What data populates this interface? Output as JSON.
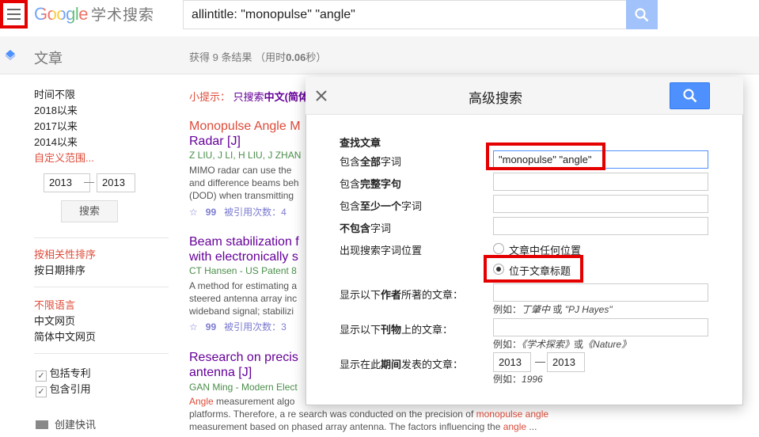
{
  "header": {
    "logo_google": "Google",
    "logo_scholar": "学术搜索",
    "search_value": "allintitle: \"monopulse\" \"angle\"",
    "search_btn_color": "#a1c2fa"
  },
  "nav": {
    "articles": "文章",
    "results_count": "获得 9 条结果 （用时",
    "results_time": "0.06",
    "results_unit": "秒）"
  },
  "sidebar": {
    "time_any": "时间不限",
    "since_2018": "2018以来",
    "since_2017": "2017以来",
    "since_2014": "2014以来",
    "custom_range": "自定义范围...",
    "year_from": "2013",
    "year_dash": "—",
    "year_to": "2013",
    "search_btn": "搜索",
    "sort_relevance": "按相关性排序",
    "sort_date": "按日期排序",
    "lang_any": "不限语言",
    "lang_cn_web": "中文网页",
    "lang_simplified": "简体中文网页",
    "include_patents": "包括专利",
    "include_citations": "包含引用",
    "create_alert": "创建快讯"
  },
  "tip": {
    "label": "小提示：",
    "text": "只搜索",
    "bold": "中文(简体"
  },
  "results": [
    {
      "title_a": "Monopulse Angle M",
      "title_b": "Radar [J]",
      "meta": "Z LIU, J LI, H LIU, J ZHAN",
      "snip1": "MIMO radar can use the",
      "snip2": "and difference beams beh",
      "snip3": "(DOD) when transmitting",
      "cited": "被引用次数：4"
    },
    {
      "title_a": "Beam stabilization f",
      "title_b": "with electronically s",
      "meta": "CT Hansen - US Patent 8",
      "snip1": "A method for estimating a",
      "snip2": "steered antenna array inc",
      "snip3": "wideband signal; stabilizi",
      "cited": "被引用次数：3"
    },
    {
      "title_a": "Research on precis",
      "title_b": "antenna [J]",
      "meta": "GAN Ming - Modern Elect",
      "snip1_em": "Angle",
      "snip1": " measurement algo",
      "snip2a": "platforms. Therefore, a re search was conducted on the precision of ",
      "snip2_em": "monopulse angle",
      "snip3a": "measurement based on phased array antenna. The factors influencing the ",
      "snip3_em": "angle",
      "snip3_end": " ..."
    }
  ],
  "dialog": {
    "title": "高级搜索",
    "find_articles": "查找文章",
    "all_words_pre": "包含",
    "all_words_bold": "全部",
    "all_words_post": "字词",
    "all_words_value": "\"monopulse\"  \"angle\"",
    "exact_pre": "包含",
    "exact_bold": "完整字句",
    "atleast_pre": "包含",
    "atleast_bold": "至少一个",
    "atleast_post": "字词",
    "without_bold": "不包含",
    "without_post": "字词",
    "where_label": "出现搜索字词位置",
    "where_anywhere": "文章中任何位置",
    "where_title": "位于文章标题",
    "author_pre": "显示以下",
    "author_bold": "作者",
    "author_post": "所著的文章：",
    "author_hint_pre": "例如：",
    "author_hint_a": "丁肇中",
    "author_hint_or": " 或 ",
    "author_hint_b": "\"PJ Hayes\"",
    "pub_pre": "显示以下",
    "pub_bold": "刊物",
    "pub_post": "上的文章：",
    "pub_hint_pre": "例如：",
    "pub_hint_a": "《学术探索》",
    "pub_hint_or": "或",
    "pub_hint_b": "《Nature》",
    "date_pre": "显示在此",
    "date_bold": "期间",
    "date_post": "发表的文章：",
    "date_from": "2013",
    "date_dash": "—",
    "date_to": "2013",
    "date_hint_pre": "例如：",
    "date_hint": "1996"
  }
}
